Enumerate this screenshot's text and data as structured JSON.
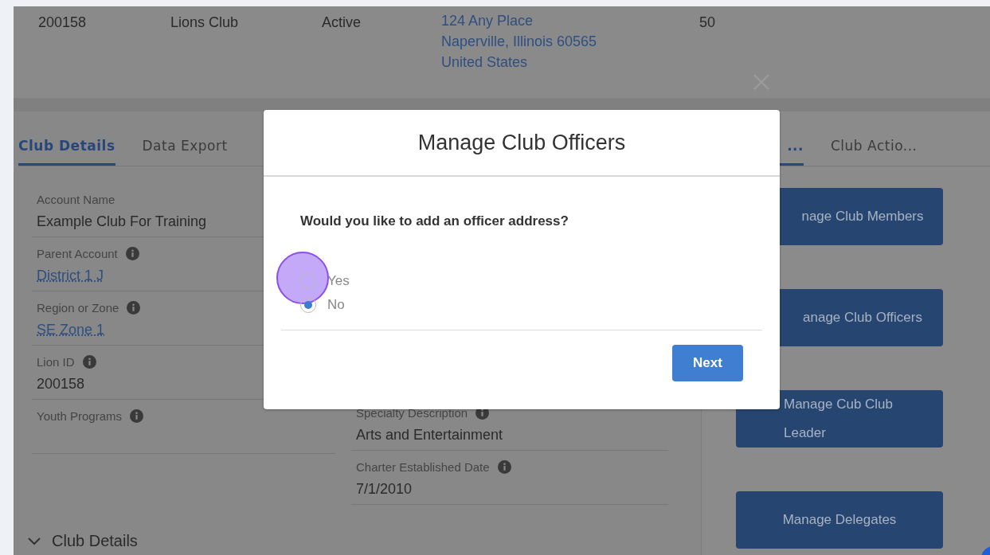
{
  "record_row": {
    "cells": [
      {
        "kind": "text",
        "text": "200158"
      },
      {
        "kind": "text",
        "text": "Lions Club"
      },
      {
        "kind": "text",
        "text": "Active"
      },
      {
        "kind": "address",
        "lines": [
          "124 Any Place",
          "Naperville, Illinois 60565",
          "United States"
        ]
      },
      {
        "kind": "text",
        "text": "50"
      }
    ]
  },
  "left_tabs": [
    {
      "label": "Club Details",
      "selected": true
    },
    {
      "label": "Data Export",
      "selected": false
    }
  ],
  "right_tabs": [
    {
      "label": "...",
      "selected": true
    },
    {
      "label": "Club Actio...",
      "selected": false
    }
  ],
  "details_left": [
    {
      "label": "Account Name",
      "info": false,
      "value": "Example Club For Training",
      "link": false
    },
    {
      "label": "Parent Account",
      "info": true,
      "value": "District 1 J",
      "link": true
    },
    {
      "label": "Region or Zone",
      "info": true,
      "value": "SE Zone 1",
      "link": true
    },
    {
      "label": "Lion ID",
      "info": true,
      "value": "200158",
      "link": false
    },
    {
      "label": "Youth Programs",
      "info": true
    }
  ],
  "details_middle": [
    {
      "label": "Specialty Description",
      "info": true,
      "value": "Arts and Entertainment",
      "link": false
    },
    {
      "label": "Charter Established Date",
      "info": true,
      "value": "7/1/2010",
      "link": false
    }
  ],
  "section": {
    "title": "Club Details",
    "expanded": true
  },
  "action_buttons": [
    "nage Club Members",
    "anage Club Officers",
    "Manage Cub Club Leader",
    "Manage Delegates"
  ],
  "modal": {
    "title": "Manage Club Officers",
    "question": "Would you like to add an officer address?",
    "options": [
      {
        "label": "Yes",
        "selected": false
      },
      {
        "label": "No",
        "selected": true
      }
    ],
    "next_button": "Next"
  }
}
